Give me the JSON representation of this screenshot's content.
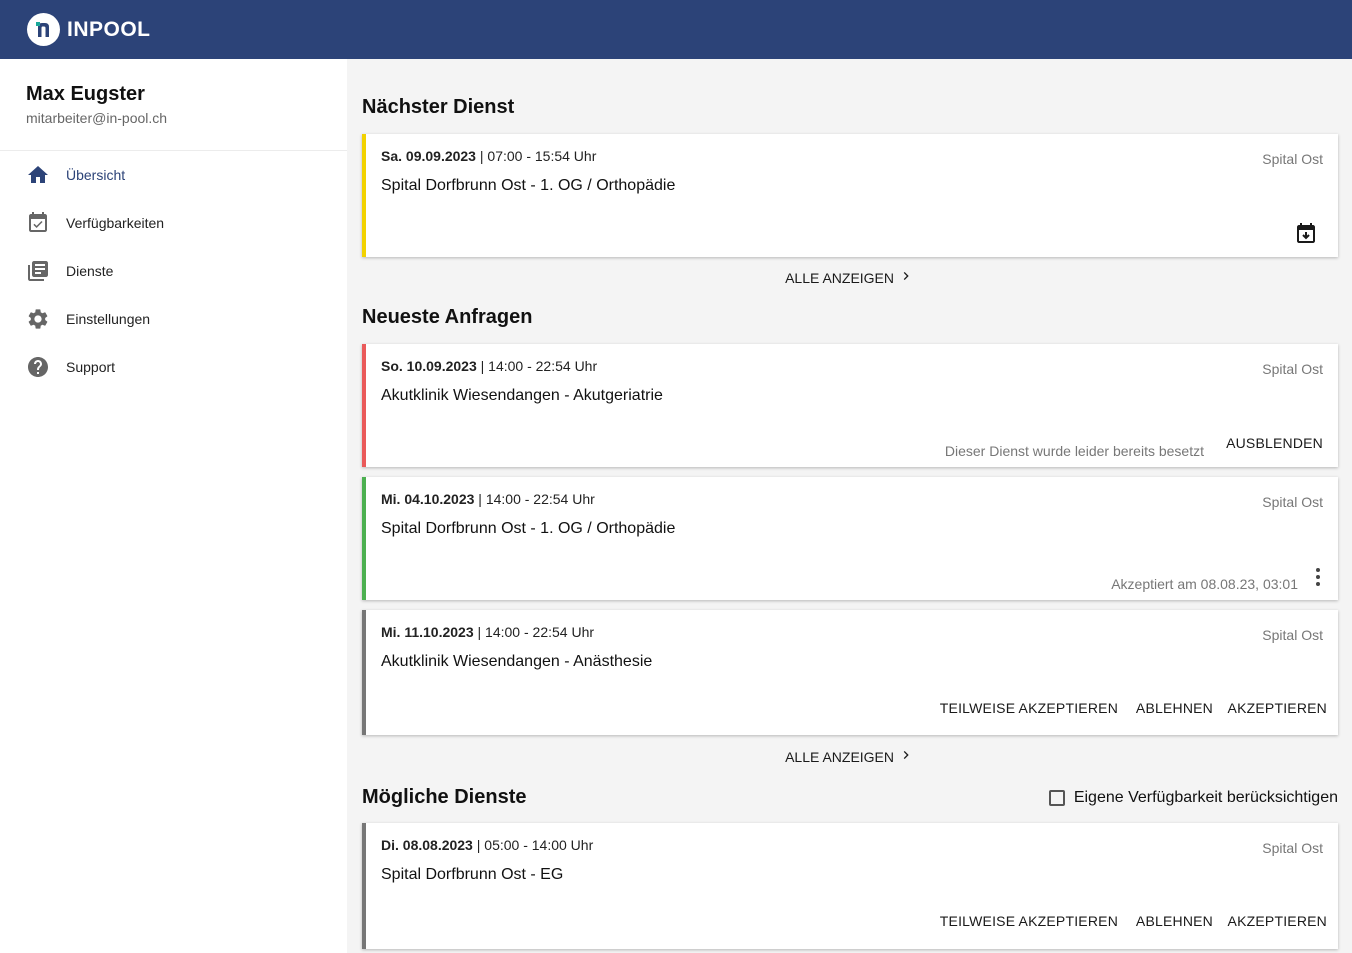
{
  "header": {
    "brand": "INPOOL"
  },
  "profile": {
    "name": "Max Eugster",
    "email": "mitarbeiter@in-pool.ch"
  },
  "nav": [
    {
      "label": "Übersicht",
      "icon": "home-icon"
    },
    {
      "label": "Verfügbarkeiten",
      "icon": "calendar-check-icon"
    },
    {
      "label": "Dienste",
      "icon": "list-icon"
    },
    {
      "label": "Einstellungen",
      "icon": "gear-icon"
    },
    {
      "label": "Support",
      "icon": "help-icon"
    }
  ],
  "sections": {
    "next": "Nächster Dienst",
    "requests": "Neueste Anfragen",
    "possible": "Mögliche Dienste"
  },
  "next_shift": {
    "date": "Sa. 09.09.2023",
    "time": "| 07:00 - 15:54 Uhr",
    "place": "Spital Dorfbrunn Ost - 1. OG / Orthopädie",
    "location": "Spital Ost",
    "accent": "#f2d200"
  },
  "show_all": "ALLE ANZEIGEN",
  "requests": [
    {
      "date": "So. 10.09.2023",
      "time": "| 14:00 - 22:54 Uhr",
      "place": "Akutklinik Wiesendangen - Akutgeriatrie",
      "location": "Spital Ost",
      "note": "Dieser Dienst wurde leider bereits besetzt",
      "action": "AUSBLENDEN",
      "accent": "#ea5a5a"
    },
    {
      "date": "Mi. 04.10.2023",
      "time": "| 14:00 - 22:54 Uhr",
      "place": "Spital Dorfbrunn Ost - 1. OG / Orthopädie",
      "location": "Spital Ost",
      "note": "Akzeptiert am 08.08.23, 03:01",
      "accent": "#4cb050"
    },
    {
      "date": "Mi. 11.10.2023",
      "time": "| 14:00 - 22:54 Uhr",
      "place": "Akutklinik Wiesendangen - Anästhesie",
      "location": "Spital Ost",
      "accent": "#777777"
    }
  ],
  "actions": {
    "partial": "TEILWEISE AKZEPTIEREN",
    "decline": "ABLEHNEN",
    "accept": "AKZEPTIEREN"
  },
  "availability_checkbox": "Eigene Verfügbarkeit berücksichtigen",
  "possible": [
    {
      "date": "Di. 08.08.2023",
      "time": "| 05:00 - 14:00 Uhr",
      "place": "Spital Dorfbrunn Ost - EG",
      "location": "Spital Ost",
      "accent": "#777777"
    }
  ]
}
